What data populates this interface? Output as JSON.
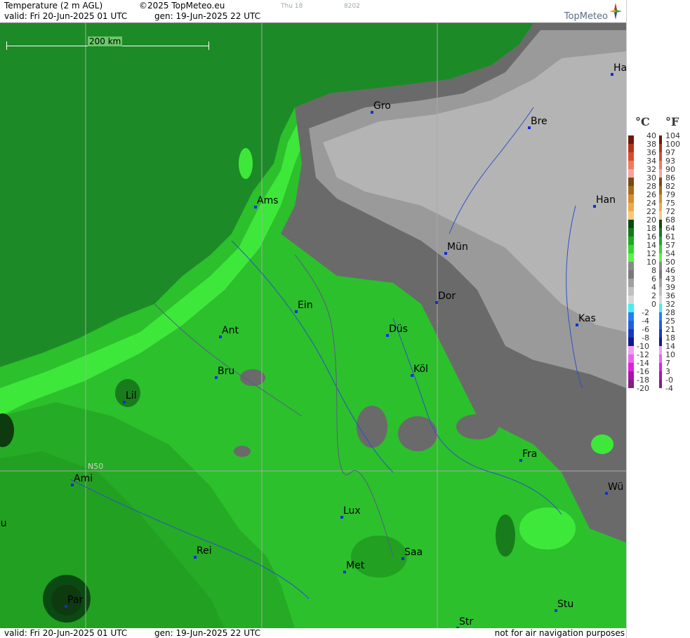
{
  "header": {
    "title": "Temperature (2 m AGL)",
    "copyright": "©2025 TopMeteo.eu",
    "valid": "valid:  Fri  20-Jun-2025  01 UTC",
    "gen": "gen: 19-Jun-2025 22 UTC",
    "day_small": "Thu 18",
    "code_small": "8202",
    "logo_text": "TopMeteo"
  },
  "scale_bar": {
    "label": "200 km"
  },
  "lat_label": "N50",
  "footer": {
    "valid": "valid:  Fri  20-Jun-2025  01 UTC",
    "gen": "gen: 19-Jun-2025 22 UTC",
    "note": "not for air navigation purposes"
  },
  "legend": {
    "celsius_header": "°C",
    "fahrenheit_header": "°F",
    "celsius": [
      "40",
      "38",
      "36",
      "34",
      "32",
      "30",
      "28",
      "26",
      "24",
      "22",
      "20",
      "18",
      "16",
      "14",
      "12",
      "10",
      "8",
      "6",
      "4",
      "2",
      "0",
      "-2",
      "-4",
      "-6",
      "-8",
      "-10",
      "-12",
      "-14",
      "-16",
      "-18",
      "-20"
    ],
    "fahrenheit": [
      "104",
      "100",
      "97",
      "93",
      "90",
      "86",
      "82",
      "79",
      "75",
      "72",
      "68",
      "64",
      "61",
      "57",
      "54",
      "50",
      "46",
      "43",
      "39",
      "36",
      "32",
      "28",
      "25",
      "21",
      "18",
      "14",
      "10",
      "7",
      "3",
      "-0",
      "-4"
    ],
    "colors": [
      "#6b1a0d",
      "#b5331a",
      "#e04a2c",
      "#f07a5a",
      "#f7a3a0",
      "#7a4a10",
      "#a86a1a",
      "#d98c28",
      "#f0a848",
      "#f8c878",
      "#0a4a12",
      "#137a1a",
      "#1eaa1e",
      "#34d62a",
      "#5cf24a",
      "#8a8a8a",
      "#7a7a7a",
      "#a0a0a0",
      "#c0c0c0",
      "#d8d8d8",
      "#40f0f0",
      "#2080f0",
      "#2060e0",
      "#1838c0",
      "#101890",
      "#f0a0f0",
      "#f060f0",
      "#e020e0",
      "#b010b0",
      "#802080"
    ]
  },
  "cities": [
    {
      "name": "Gro"
    },
    {
      "name": "Bre"
    },
    {
      "name": "Ha"
    },
    {
      "name": "Ams"
    },
    {
      "name": "Han"
    },
    {
      "name": "Mün"
    },
    {
      "name": "Dor"
    },
    {
      "name": "Ein"
    },
    {
      "name": "Ant"
    },
    {
      "name": "Düs"
    },
    {
      "name": "Kas"
    },
    {
      "name": "Bru"
    },
    {
      "name": "Köl"
    },
    {
      "name": "Lil"
    },
    {
      "name": "Fra"
    },
    {
      "name": "Ami"
    },
    {
      "name": "Wü"
    },
    {
      "name": "Lux"
    },
    {
      "name": "ou"
    },
    {
      "name": "Rei"
    },
    {
      "name": "Saa"
    },
    {
      "name": "Met"
    },
    {
      "name": "Par"
    },
    {
      "name": "Stu"
    },
    {
      "name": "Str"
    }
  ]
}
